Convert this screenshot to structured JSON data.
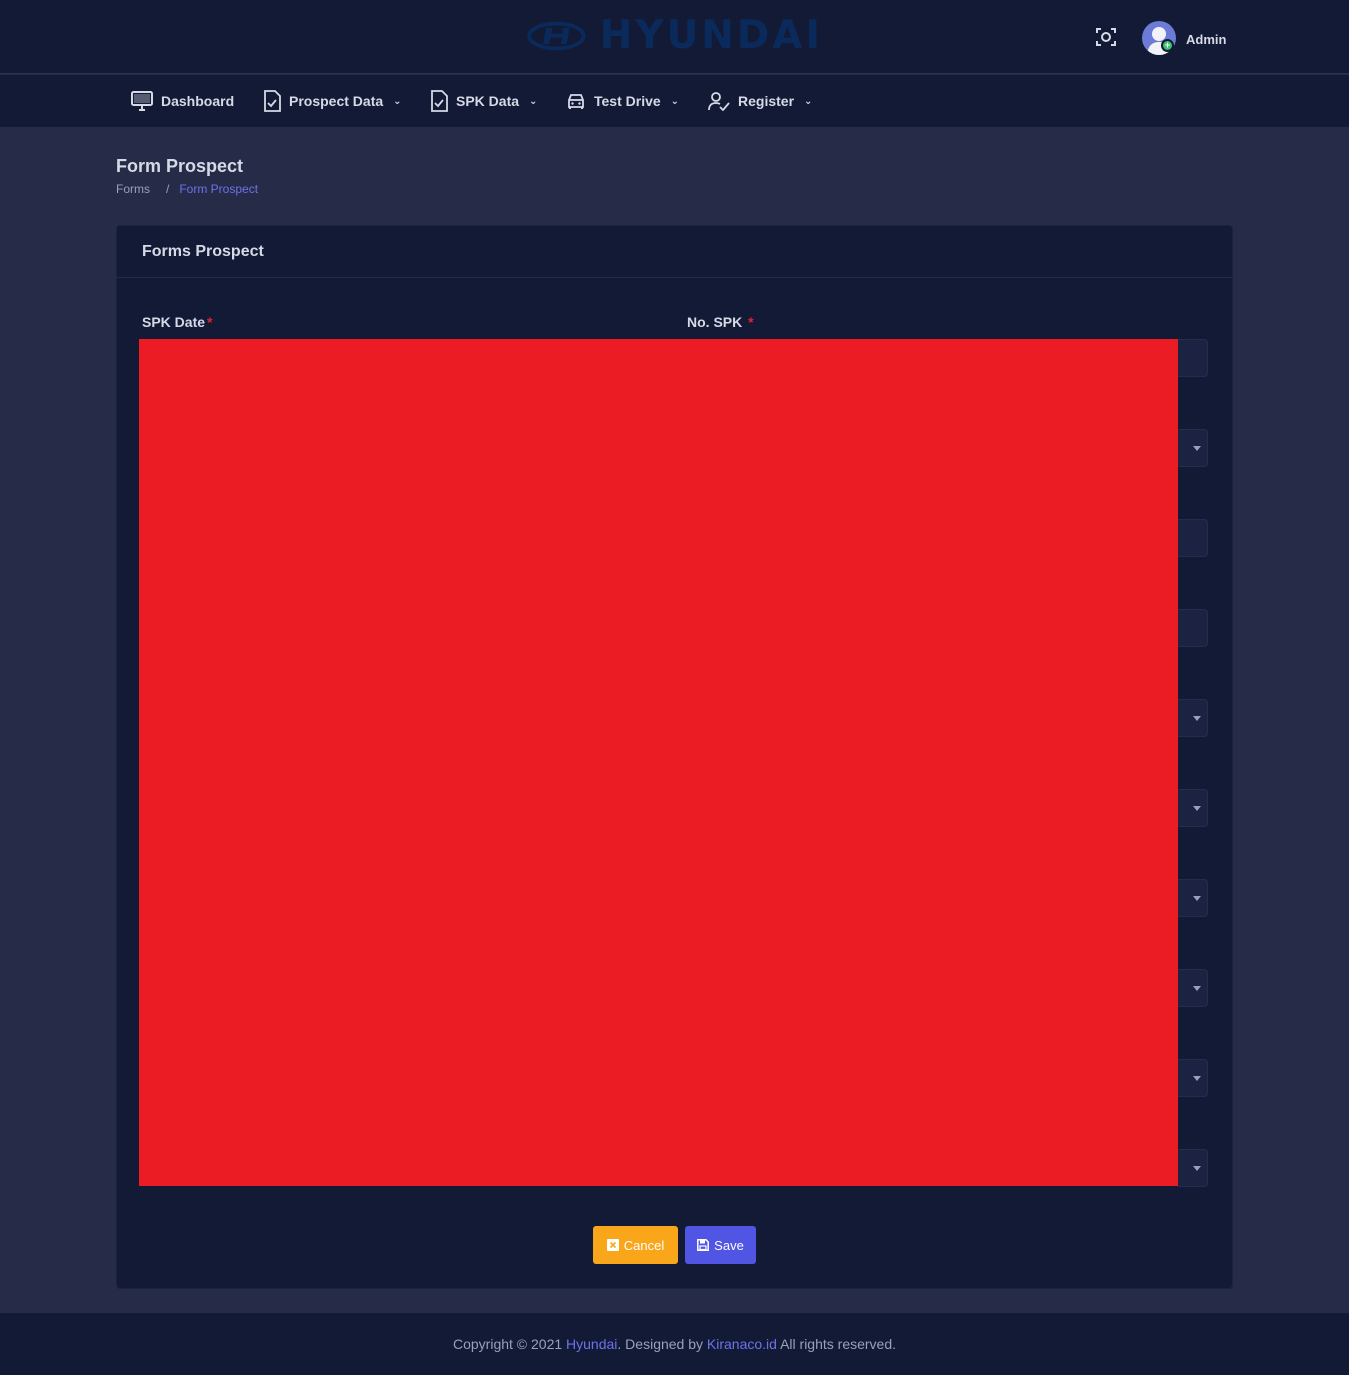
{
  "header": {
    "logo_text": "HYUNDAI",
    "user_name": "Admin",
    "avatar_badge": "+"
  },
  "nav": {
    "items": [
      {
        "label": "Dashboard",
        "icon": "monitor-icon",
        "has_dropdown": false
      },
      {
        "label": "Prospect Data",
        "icon": "document-check-icon",
        "has_dropdown": true
      },
      {
        "label": "SPK Data",
        "icon": "document-check-icon",
        "has_dropdown": true
      },
      {
        "label": "Test Drive",
        "icon": "car-icon",
        "has_dropdown": true
      },
      {
        "label": "Register",
        "icon": "user-check-icon",
        "has_dropdown": true
      }
    ]
  },
  "page": {
    "title": "Form Prospect",
    "breadcrumb": [
      "Forms",
      "Form Prospect"
    ]
  },
  "card": {
    "title": "Forms Prospect",
    "fields": {
      "spk_date_label": "SPK Date",
      "no_spk_label": "No. SPK",
      "required_mark": "*"
    },
    "buttons": {
      "cancel": "Cancel",
      "save": "Save"
    }
  },
  "footer": {
    "prefix": "Copyright © 2021",
    "brand": "Hyundai",
    "middle": ". Designed by",
    "designer": "Kiranaco.id",
    "suffix": "All rights reserved."
  },
  "colors": {
    "background": "#262c48",
    "panel": "#131a36",
    "accent": "#5055e3",
    "warning": "#f9a61a",
    "redaction": "#ec1c24"
  }
}
